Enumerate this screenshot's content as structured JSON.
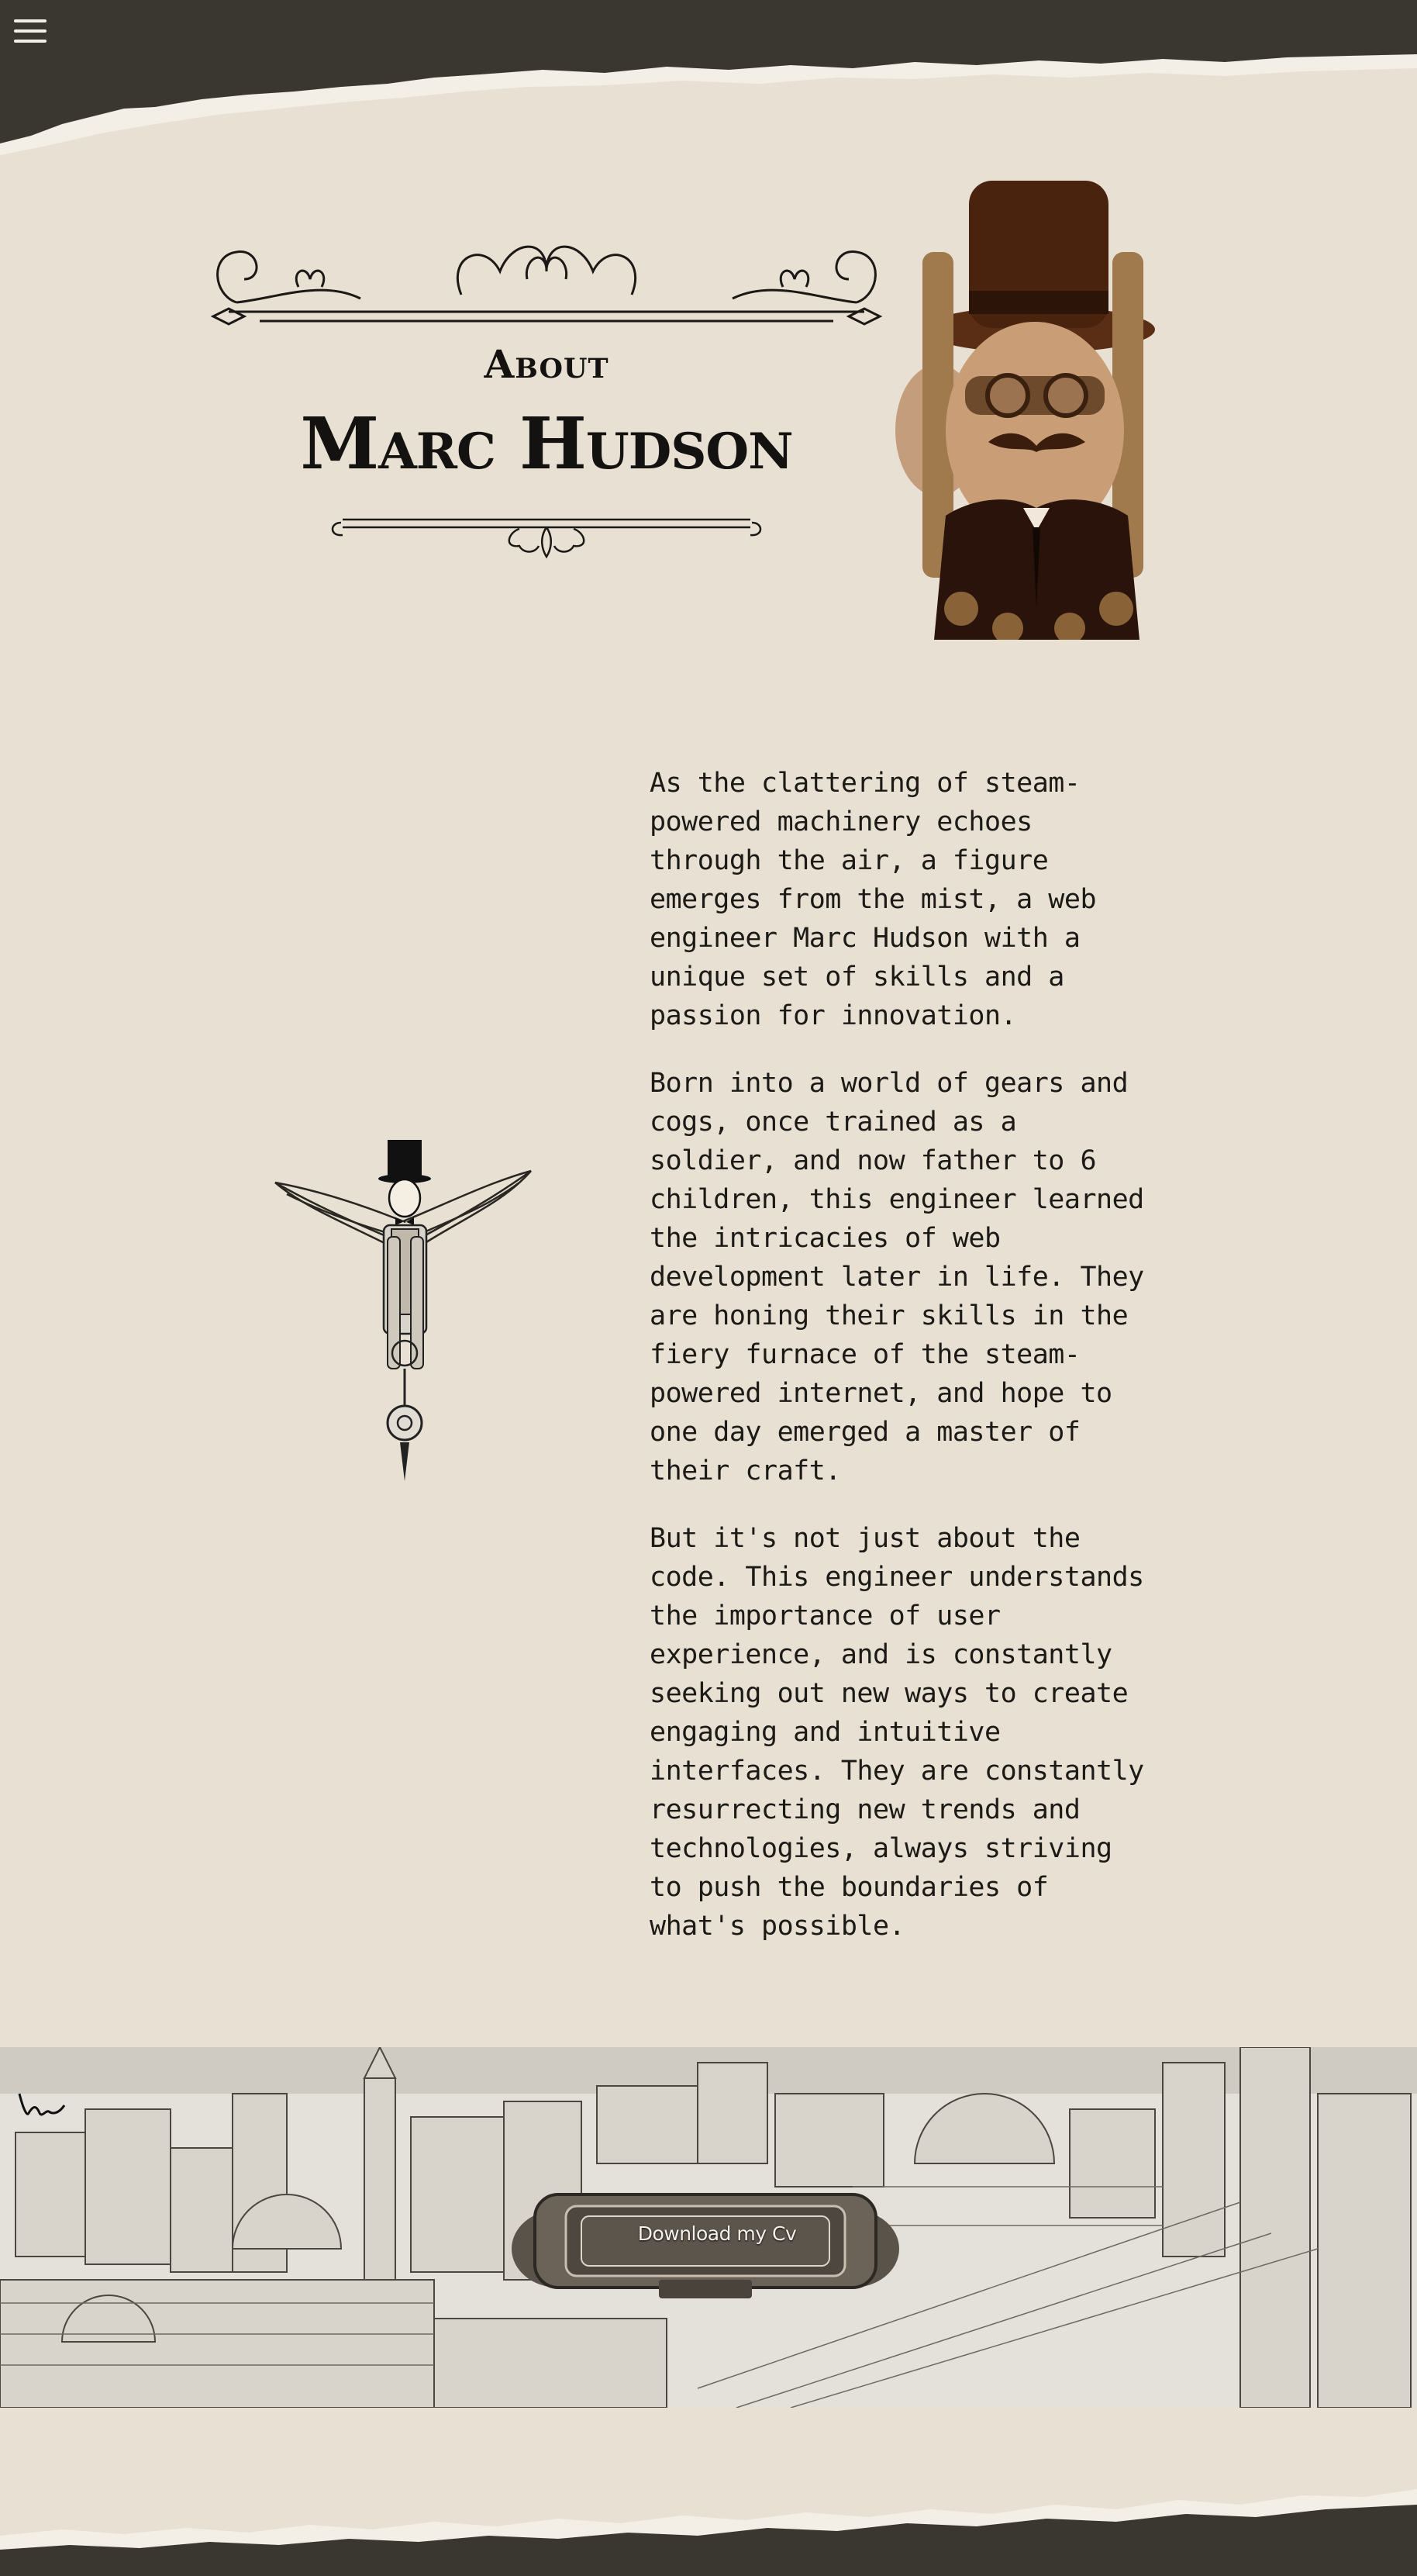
{
  "header": {
    "menu_icon": "hamburger-menu-icon",
    "colors": {
      "dark_band": "#3a3731",
      "paper": "#e8e1d3",
      "ink": "#141210"
    }
  },
  "hero": {
    "label": "About",
    "name": "Marc Hudson",
    "portrait": "steampunk-gentleman-portrait"
  },
  "bio": {
    "paragraphs": [
      "As the clattering of steam-powered machinery echoes through the air, a figure emerges from the mist, a web engineer Marc Hudson with a unique set of skills and a passion for innovation.",
      "Born into a world of gears and cogs, once trained as a soldier, and now father to 6 children, this engineer learned the intricacies of web development later in life. They are honing their skills in the fiery furnace of the steam-powered internet, and hope to one day emerged a master of their craft.",
      "But it's not just about the code. This engineer understands the importance of user experience, and is constantly seeking out new ways to create engaging and intuitive interfaces. They are constantly resurrecting new trends and technologies, always striving to push the boundaries of what's possible."
    ],
    "illustration": "winged-gentleman-illustration"
  },
  "footer_city": {
    "cv_button_label": "Download my Cv",
    "signature": "ken"
  }
}
